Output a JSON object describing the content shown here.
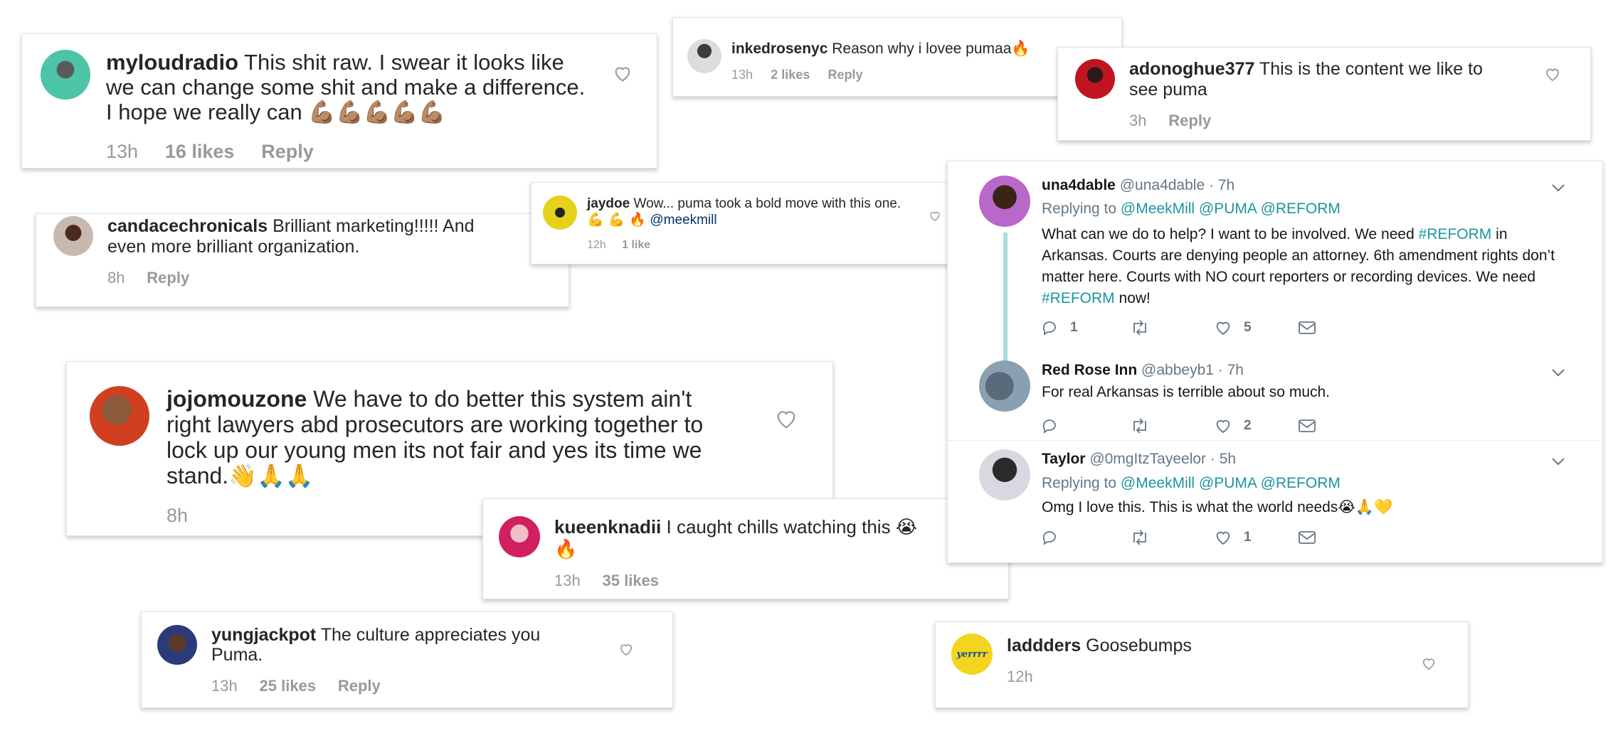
{
  "comments": [
    {
      "id": "myloudradio",
      "user": "myloudradio",
      "text": "This shit raw. I swear it looks like we can change some shit and make a difference. I hope we really can",
      "emoji": "💪🏽💪🏽💪🏽💪🏽💪🏽",
      "time": "13h",
      "likes": "16 likes",
      "reply": "Reply"
    },
    {
      "id": "inkedrosenyc",
      "user": "inkedrosenyc",
      "text": "Reason why i lovee pumaa",
      "emoji": "🔥",
      "time": "13h",
      "likes": "2 likes",
      "reply": "Reply"
    },
    {
      "id": "adonoghue377",
      "user": "adonoghue377",
      "text": "This is the content we like to see puma",
      "time": "3h",
      "reply": "Reply"
    },
    {
      "id": "candacechronicals",
      "user": "candacechronicals",
      "text": "Brilliant marketing!!!!! And even more brilliant organization.",
      "time": "8h",
      "reply": "Reply"
    },
    {
      "id": "jaydoe",
      "user": "jaydoe",
      "text": "Wow... puma took a bold move with this one.",
      "emoji": "💪 💪 🔥",
      "mention": "@meekmill",
      "time": "12h",
      "likes": "1 like"
    },
    {
      "id": "jojomouzone",
      "user": "jojomouzone",
      "text": "We have to do better this system ain't right lawyers abd prosecutors are working together to lock up our young men its not fair and yes its time we stand.",
      "emoji": "👋🙏🙏",
      "time": "8h"
    },
    {
      "id": "kueenknadii",
      "user": "kueenknadii",
      "text": "I caught chills watching this",
      "emoji": "😭",
      "emoji2": "🔥",
      "time": "13h",
      "likes": "35 likes"
    },
    {
      "id": "yungjackpot",
      "user": "yungjackpot",
      "text": "The culture appreciates you Puma.",
      "time": "13h",
      "likes": "25 likes",
      "reply": "Reply"
    },
    {
      "id": "laddders",
      "user": "laddders",
      "text": "Goosebumps",
      "time": "12h",
      "avatar_text": "yerrrr"
    }
  ],
  "twitter": {
    "tweets": [
      {
        "name": "una4dable",
        "handle": "@una4dable · 7h",
        "replying_label": "Replying to",
        "replying_to": "@MeekMill @PUMA @REFORM",
        "text_1": "What can we do to help? I want to be involved. We need",
        "hashtag_1": "#REFORM",
        "text_2": "in Arkansas. Courts are denying people an attorney. 6th amendment rights don’t matter here. Courts with NO court reporters or recording devices. We need",
        "hashtag_2": "#REFORM",
        "text_3": "now!",
        "replies": "1",
        "likes": "5"
      },
      {
        "name": "Red Rose Inn",
        "handle": "@abbeyb1 · 7h",
        "text": "For real Arkansas is terrible about so much.",
        "likes": "2"
      },
      {
        "name": "Taylor",
        "handle": "@0mgItzTayeelor · 5h",
        "replying_label": "Replying to",
        "replying_to": "@MeekMill @PUMA @REFORM",
        "text": "Omg I love this. This is what the world needs",
        "emoji": "😭🙏💛",
        "likes": "1"
      }
    ]
  },
  "icon_names": [
    "heart-icon",
    "reply-icon",
    "retweet-icon",
    "like-icon",
    "mail-icon",
    "chevron-down-icon"
  ],
  "colors": {
    "meta_gray": "#999999",
    "twitter_link": "#1b95e0",
    "twitter_gray": "#657786",
    "thread": "#a8dede"
  }
}
